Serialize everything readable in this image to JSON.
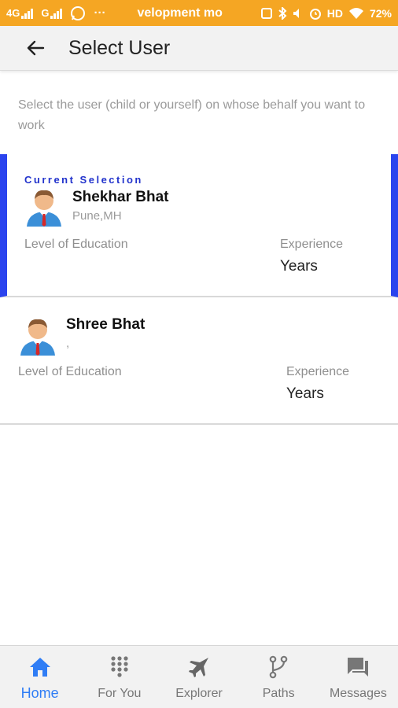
{
  "status_bar": {
    "network_1": "4G",
    "network_2": "G",
    "ticker": "velopment mo",
    "battery": "72%",
    "hd": "HD",
    "more": "···"
  },
  "app_bar": {
    "title": "Select User",
    "back_icon": "arrow-left-icon"
  },
  "intro_text": "Select the user (child or yourself) on whose behalf you want to work",
  "users": [
    {
      "current_label": "Current Selection",
      "name": "Shekhar Bhat",
      "location": "Pune,MH",
      "education_label": "Level of Education",
      "experience_label": "Experience",
      "experience_value": "Years",
      "selected": true
    },
    {
      "name": "Shree Bhat",
      "location": ",",
      "education_label": "Level of Education",
      "experience_label": "Experience",
      "experience_value": "Years",
      "selected": false
    }
  ],
  "bottom_nav": [
    {
      "label": "Home",
      "icon": "home-icon",
      "active": true
    },
    {
      "label": "For You",
      "icon": "dial-pad-icon",
      "active": false
    },
    {
      "label": "Explorer",
      "icon": "airplane-icon",
      "active": false
    },
    {
      "label": "Paths",
      "icon": "fork-icon",
      "active": false
    },
    {
      "label": "Messages",
      "icon": "chat-icon",
      "active": false
    }
  ],
  "colors": {
    "status_bar": "#f5a623",
    "selection_accent": "#2b44ee",
    "nav_active": "#2f7df5",
    "nav_inactive": "#777777"
  }
}
